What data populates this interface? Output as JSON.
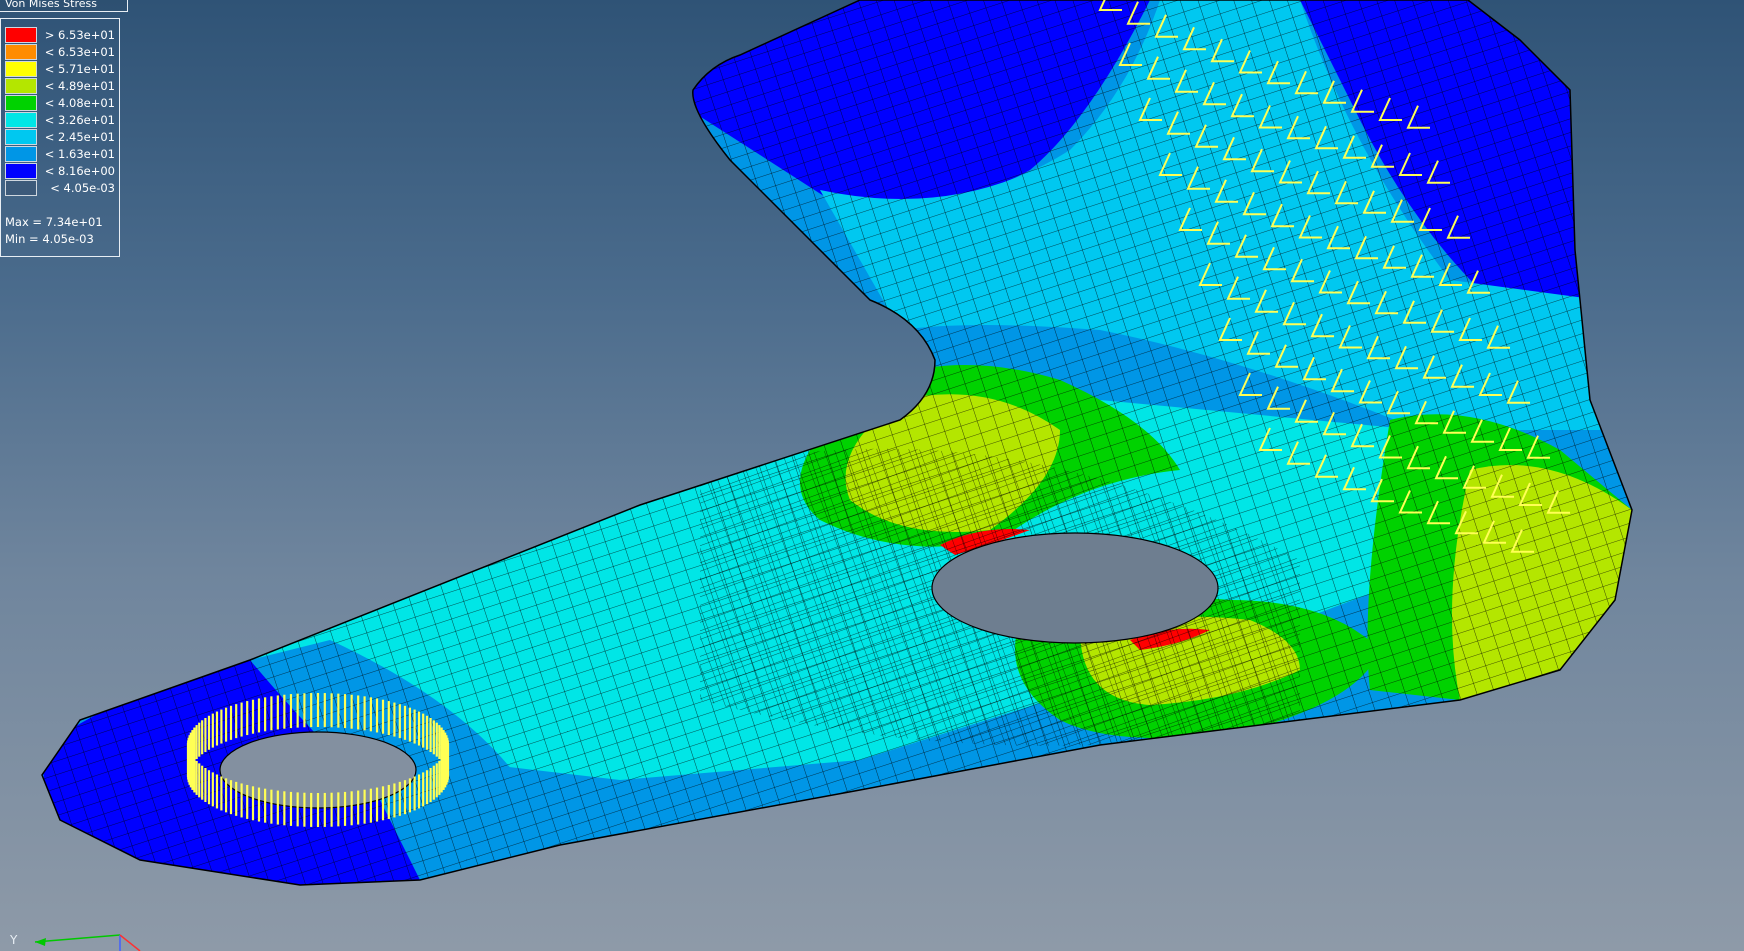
{
  "panel": {
    "title": "Von Mises Stress"
  },
  "legend": {
    "entries": [
      {
        "label": "> 6.53e+01",
        "color": "#ff0000"
      },
      {
        "label": "< 6.53e+01",
        "color": "#ff8c00"
      },
      {
        "label": "< 5.71e+01",
        "color": "#ffff00"
      },
      {
        "label": "< 4.89e+01",
        "color": "#b4e600"
      },
      {
        "label": "< 4.08e+01",
        "color": "#00d200"
      },
      {
        "label": "< 3.26e+01",
        "color": "#00e6e6"
      },
      {
        "label": "< 2.45e+01",
        "color": "#00c8f0"
      },
      {
        "label": "< 1.63e+01",
        "color": "#0096e6"
      },
      {
        "label": "< 8.16e+00",
        "color": "#0000ff"
      },
      {
        "label": "< 4.05e-03",
        "color": "#3c5a7a"
      }
    ],
    "max_text": "Max = 7.34e+01",
    "min_text": "Min = 4.05e-03"
  },
  "triad": {
    "y_label": "Y",
    "y_color": "#00c800",
    "x_color": "#ff3030",
    "z_color": "#4060ff"
  },
  "model": {
    "mesh_edge_color": "#000000",
    "constraint_color": "#ffff55",
    "load_color": "#ffff55"
  }
}
